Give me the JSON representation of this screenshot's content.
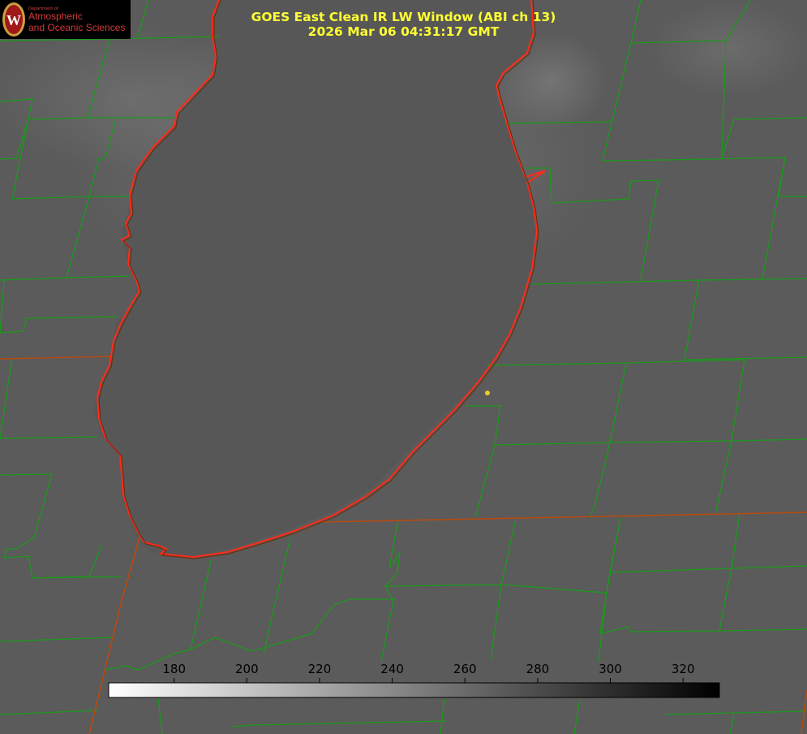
{
  "title": {
    "line1": "GOES East Clean IR LW Window (ABI ch 13)",
    "line2": "2026 Mar 06 04:31:17 GMT"
  },
  "logo": {
    "dept": "Department of",
    "line1": "Atmospheric",
    "line2": "and Oceanic Sciences",
    "seal_letter": "W"
  },
  "colorbar": {
    "ticks": [
      "180",
      "200",
      "220",
      "240",
      "260",
      "280",
      "300",
      "320"
    ],
    "tick_values": [
      180,
      200,
      220,
      240,
      260,
      280,
      300,
      320
    ],
    "range": [
      162,
      330
    ],
    "colormap": "white-to-black"
  },
  "colors": {
    "title": "#ffff33",
    "county_borders": "#1a9a1a",
    "shoreline": "#ff2a1a",
    "state_border": "#b84a10",
    "marker": "#e8d020"
  }
}
